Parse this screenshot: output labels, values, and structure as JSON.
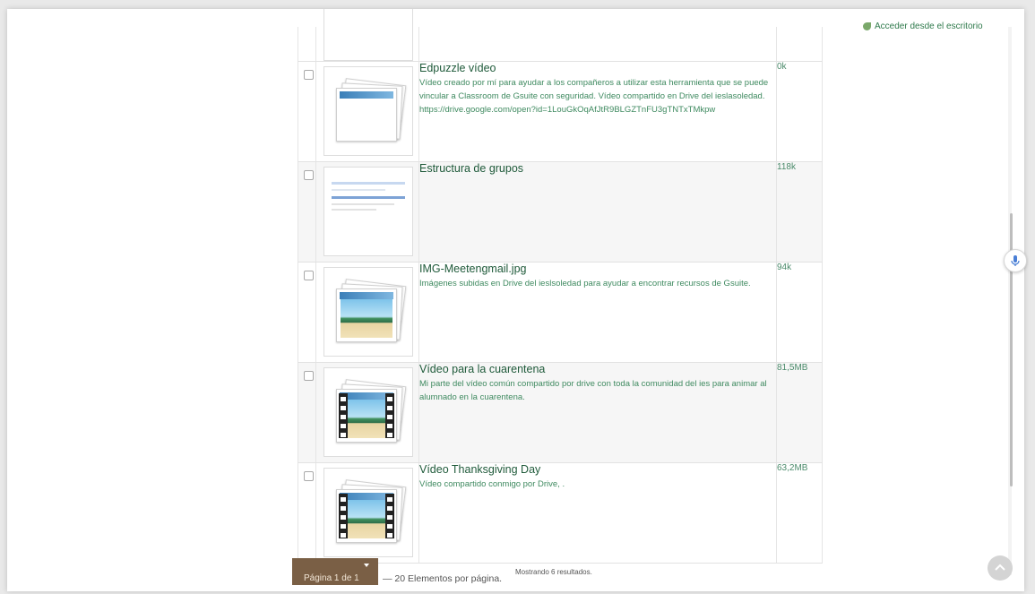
{
  "sidebar_right": {
    "link_label": "Acceder desde el escritorio"
  },
  "files": [
    {
      "title": "Edpuzzle vídeo",
      "description": "Vídeo creado por mí para ayudar a los compañeros a utilizar esta herramienta que se puede vincular a Classroom de Gsuite con seguridad. Vídeo compartido en Drive del ieslasoledad. https://drive.google.com/open?id=1LouGkOqAfJtR9BLGZTnFU3gTNTxTMkpw",
      "size": "0k",
      "thumb": "photo-stack-blank"
    },
    {
      "title": "Estructura de grupos",
      "description": "",
      "size": "118k",
      "thumb": "screenshot"
    },
    {
      "title": "IMG-Meetengmail.jpg",
      "description": "Imágenes subidas en Drive del ieslsoledad para ayudar a encontrar recursos de Gsuite.",
      "size": "94k",
      "thumb": "photo-stack-beach"
    },
    {
      "title": "Vídeo para la cuarentena",
      "description": "Mi parte del vídeo común compartido por drive con toda la comunidad del ies para animar al alumnado en la cuarentena.",
      "size": "81,5MB",
      "thumb": "video-stack"
    },
    {
      "title": "Vídeo Thanksgiving Day",
      "description": "Vídeo compartido conmigo por Drive, .",
      "size": "63,2MB",
      "thumb": "video-stack"
    }
  ],
  "footer": {
    "pager_label": "Página 1 de 1",
    "per_page": "— 20 Elementos por página.",
    "results": "Mostrando 6 resultados."
  },
  "colors": {
    "title": "#1f5a3a",
    "description": "#3f8a60",
    "pager_bg": "#7a5f45"
  }
}
